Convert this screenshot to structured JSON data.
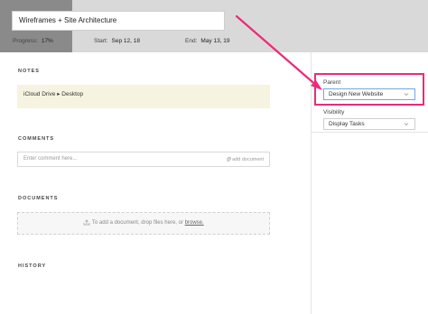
{
  "task": {
    "title": "Wireframes + Site Architecture",
    "progress_label": "Progress:",
    "progress_value": "17%",
    "start_label": "Start:",
    "start_value": "Sep 12, 18",
    "end_label": "End:",
    "end_value": "May 13, 19"
  },
  "sections": {
    "notes": "NOTES",
    "comments": "COMMENTS",
    "documents": "DOCUMENTS",
    "history": "HISTORY"
  },
  "notes": {
    "location": "iCloud Drive ▸ Desktop"
  },
  "comments": {
    "placeholder": "Enter comment here...",
    "add_document": "add document"
  },
  "documents": {
    "drop_text": "To add a document, drop files here, or",
    "browse": "browse."
  },
  "sidebar": {
    "parent_label": "Parent",
    "parent_value": "Design New Website",
    "visibility_label": "Visibility",
    "visibility_value": "Display Tasks"
  },
  "colors": {
    "highlight": "#ec2a7a",
    "header_band": "#d9d9d9",
    "notes_bg": "#f6f3e0"
  },
  "icons": [
    "paperclip-icon",
    "upload-icon",
    "chevron-down-icon"
  ]
}
